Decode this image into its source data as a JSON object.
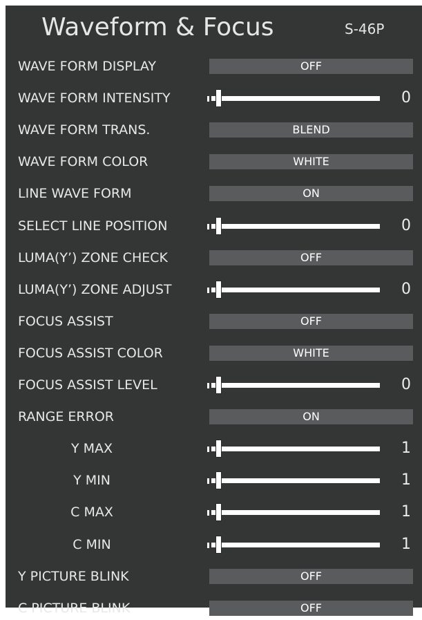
{
  "header": {
    "title": "Waveform & Focus",
    "model": "S-46P"
  },
  "colors": {
    "background": "#343535",
    "control_fill": "#5a5b5d",
    "text": "#ececec",
    "slider": "#ffffff"
  },
  "rows": [
    {
      "label": "WAVE FORM DISPLAY",
      "type": "select",
      "value": "OFF",
      "align": "left"
    },
    {
      "label": "WAVE FORM INTENSITY",
      "type": "slider",
      "value": "0",
      "level": 0,
      "align": "left"
    },
    {
      "label": "WAVE FORM TRANS.",
      "type": "select",
      "value": "BLEND",
      "align": "left"
    },
    {
      "label": "WAVE FORM COLOR",
      "type": "select",
      "value": "WHITE",
      "align": "left"
    },
    {
      "label": "LINE WAVE FORM",
      "type": "select",
      "value": "ON",
      "align": "left"
    },
    {
      "label": "SELECT LINE POSITION",
      "type": "slider",
      "value": "0",
      "level": 0,
      "align": "left"
    },
    {
      "label": "LUMA(Y’) ZONE CHECK",
      "type": "select",
      "value": "OFF",
      "align": "left"
    },
    {
      "label": "LUMA(Y’) ZONE ADJUST",
      "type": "slider",
      "value": "0",
      "level": 0,
      "align": "left"
    },
    {
      "label": "FOCUS ASSIST",
      "type": "select",
      "value": "OFF",
      "align": "left"
    },
    {
      "label": "FOCUS ASSIST COLOR",
      "type": "select",
      "value": "WHITE",
      "align": "left"
    },
    {
      "label": "FOCUS ASSIST LEVEL",
      "type": "slider",
      "value": "0",
      "level": 0,
      "align": "left"
    },
    {
      "label": "RANGE ERROR",
      "type": "select",
      "value": "ON",
      "align": "left"
    },
    {
      "label": "Y MAX",
      "type": "slider",
      "value": "1",
      "level": 0.0,
      "align": "center"
    },
    {
      "label": "Y MIN",
      "type": "slider",
      "value": "1",
      "level": 0.0,
      "align": "center"
    },
    {
      "label": "C MAX",
      "type": "slider",
      "value": "1",
      "level": 0.0,
      "align": "center"
    },
    {
      "label": "C MIN",
      "type": "slider",
      "value": "1",
      "level": 0.0,
      "align": "center"
    },
    {
      "label": "Y PICTURE BLINK",
      "type": "select",
      "value": "OFF",
      "align": "left"
    },
    {
      "label": "C PICTURE BLINK",
      "type": "select",
      "value": "OFF",
      "align": "left"
    }
  ]
}
